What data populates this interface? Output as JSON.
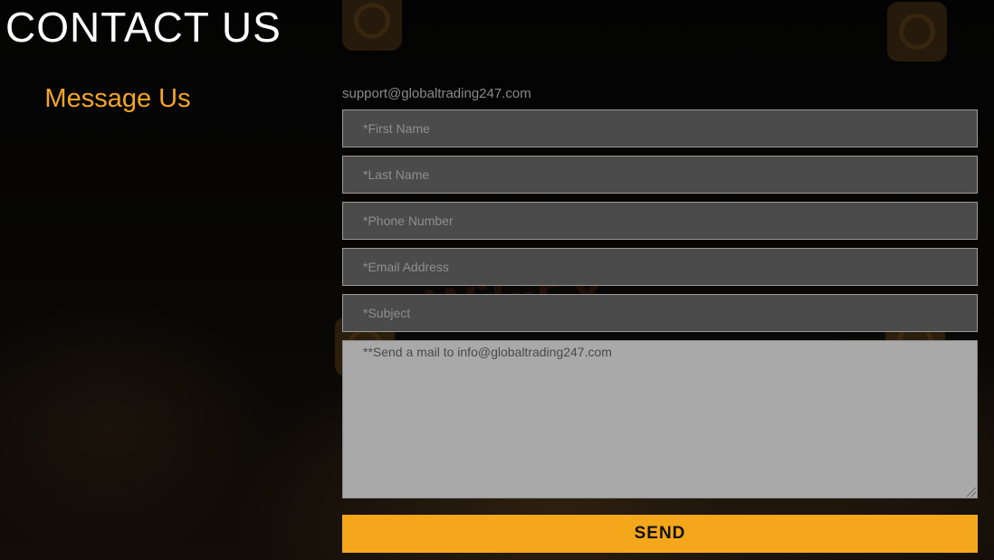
{
  "header": {
    "title": "CONTACT US"
  },
  "sidebar": {
    "heading": "Message Us"
  },
  "contact": {
    "support_email": "support@globaltrading247.com"
  },
  "form": {
    "first_name": {
      "placeholder": "*First Name",
      "value": ""
    },
    "last_name": {
      "placeholder": "*Last Name",
      "value": ""
    },
    "phone": {
      "placeholder": "*Phone Number",
      "value": ""
    },
    "email": {
      "placeholder": "*Email Address",
      "value": ""
    },
    "subject": {
      "placeholder": "*Subject",
      "value": ""
    },
    "message": {
      "placeholder": "**Send a mail to info@globaltrading247.com",
      "value": ""
    },
    "submit_label": "SEND"
  },
  "watermark": {
    "text": "WikiFX"
  },
  "colors": {
    "accent": "#f5a623",
    "button": "#f5a71c",
    "field_bg": "#4b4b4b",
    "textarea_bg": "#a9a9a9",
    "background": "#050505"
  }
}
